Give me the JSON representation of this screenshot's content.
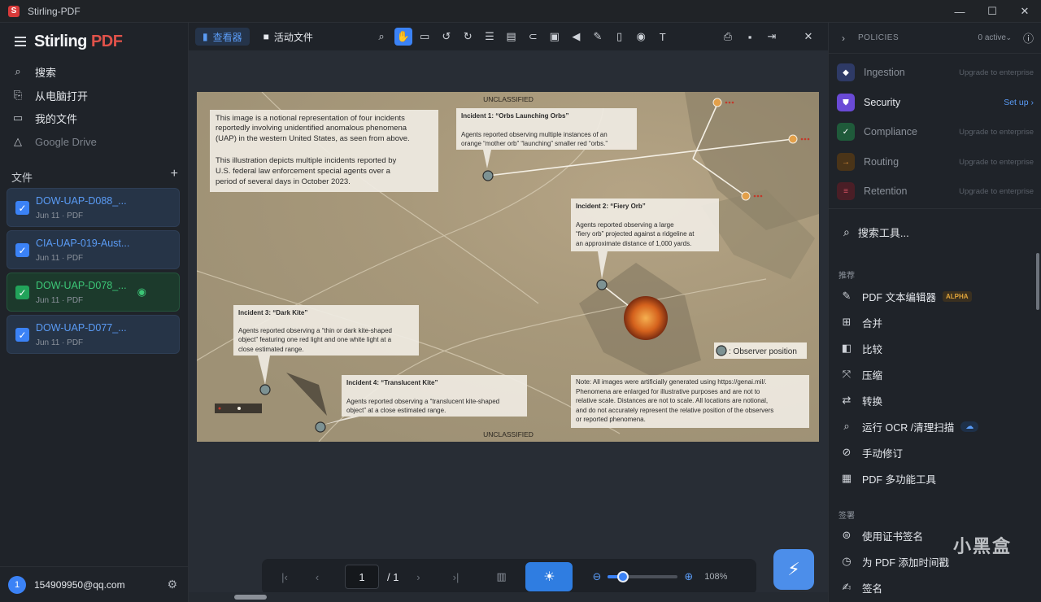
{
  "window": {
    "title": "Stirling-PDF",
    "app_icon": "S"
  },
  "sidebar": {
    "logo_main": "Stirling ",
    "logo_accent": "PDF",
    "nav": [
      {
        "label": "搜索",
        "icon": "search-icon"
      },
      {
        "label": "从电脑打开",
        "icon": "file-upload-icon"
      },
      {
        "label": "我的文件",
        "icon": "folder-icon"
      },
      {
        "label": "Google Drive",
        "icon": "google-drive-icon"
      }
    ],
    "files_header": "文件",
    "files_add": "+",
    "files": [
      {
        "name": "DOW-UAP-D088_...",
        "date": "Jun 11 · PDF"
      },
      {
        "name": "CIA-UAP-019-Aust...",
        "date": "Jun 11 · PDF"
      },
      {
        "name": "DOW-UAP-D078_...",
        "date": "Jun 11 · PDF"
      },
      {
        "name": "DOW-UAP-D077_...",
        "date": "Jun 11 · PDF"
      }
    ],
    "user": {
      "initial": "1",
      "email": "154909950@qq.com"
    }
  },
  "toolbar": {
    "tab_viewer": "查看器",
    "tab_active_files": "活动文件",
    "tools": [
      "search-icon",
      "pan-icon",
      "ruler-icon",
      "rotate-left-icon",
      "rotate-right-icon",
      "list-icon",
      "page-settings-icon",
      "attachment-icon",
      "comment-icon",
      "speaker-icon",
      "pen-icon",
      "file-lock-icon",
      "eye-icon",
      "text-size-icon"
    ],
    "right_tools": [
      "print-icon",
      "save-icon",
      "export-icon",
      "close-icon"
    ]
  },
  "document": {
    "header": "UNCLASSIFIED",
    "footer": "UNCLASSIFIED",
    "intro": [
      "This image is a notional representation of four incidents",
      "reportedly involving unidentified anomalous phenomena",
      "(UAP) in the western United States, as seen from above.",
      "",
      "This illustration depicts multiple incidents reported by",
      "U.S. federal law enforcement special agents over a",
      "period of several days in October 2023."
    ],
    "incidents": [
      {
        "title": "Incident 1: “Orbs Launching Orbs”",
        "lines": [
          "Agents reported observing multiple instances of an",
          "orange “mother orb” “launching” smaller red “orbs.”"
        ]
      },
      {
        "title": "Incident 2: “Fiery Orb”",
        "lines": [
          "Agents reported observing a large",
          "“fiery orb” projected against a ridgeline at",
          "an approximate distance of 1,000 yards."
        ]
      },
      {
        "title": "Incident 3: “Dark Kite”",
        "lines": [
          "Agents reported observing a “thin or dark kite-shaped",
          "object” featuring one red light and one white light at a",
          "close estimated range."
        ]
      },
      {
        "title": "Incident 4: “Translucent Kite”",
        "lines": [
          "Agents reported observing a “translucent kite-shaped",
          "object” at a close estimated range."
        ]
      }
    ],
    "legend": ": Observer position",
    "note": [
      "Note: All images were artificially generated using https://genai.mil/.",
      "Phenomena are enlarged for illustrative purposes and are not to",
      "relative scale. Distances are not to scale. All locations are notional,",
      "and do not accurately represent the relative position of the observers",
      "or reported phenomena."
    ]
  },
  "pager": {
    "page": "1",
    "total": "/ 1",
    "zoom": "108%",
    "zoom_level": 0.22
  },
  "right_panel": {
    "policies_label": "POLICIES",
    "policies_active": "0 active",
    "policies": [
      {
        "name": "Ingestion",
        "status": "Upgrade to enterprise",
        "color": "#3b4a86"
      },
      {
        "name": "Security",
        "status": "Set up",
        "color": "#6a4ad6"
      },
      {
        "name": "Compliance",
        "status": "Upgrade to enterprise",
        "color": "#1f8a4e"
      },
      {
        "name": "Routing",
        "status": "Upgrade to enterprise",
        "color": "#b46a1e"
      },
      {
        "name": "Retention",
        "status": "Upgrade to enterprise",
        "color": "#a43a4a"
      }
    ],
    "search_tools": "搜索工具...",
    "cat_recommended": "推荐",
    "recommended": [
      {
        "label": "PDF 文本编辑器",
        "icon": "text-edit-icon",
        "badge": "ALPHA"
      },
      {
        "label": "合并",
        "icon": "merge-icon"
      },
      {
        "label": "比较",
        "icon": "compare-icon"
      },
      {
        "label": "压缩",
        "icon": "compress-icon"
      },
      {
        "label": "转换",
        "icon": "convert-icon"
      },
      {
        "label": "运行 OCR /清理扫描",
        "icon": "ocr-icon"
      },
      {
        "label": "手动修订",
        "icon": "redact-icon"
      },
      {
        "label": "PDF 多功能工具",
        "icon": "multitool-icon"
      }
    ],
    "cat_sign": "签署",
    "sign": [
      {
        "label": "使用证书签名",
        "icon": "certificate-icon"
      },
      {
        "label": "为 PDF 添加时间戳",
        "icon": "clock-icon"
      },
      {
        "label": "签名",
        "icon": "signature-icon"
      }
    ],
    "watermark": "小黑盒"
  }
}
